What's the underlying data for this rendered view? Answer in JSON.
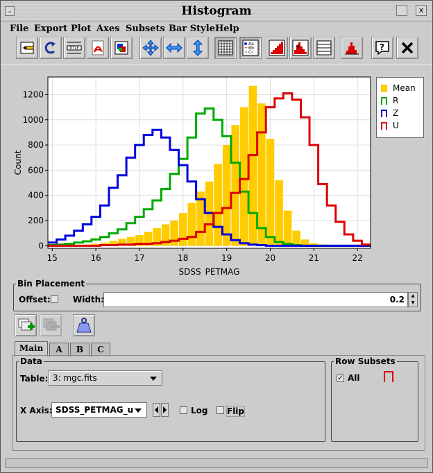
{
  "window": {
    "title": "Histogram",
    "close_icon": "x",
    "menu_icon": "-"
  },
  "menu": {
    "items": [
      "File",
      "Export",
      "Plot",
      "Axes",
      "Subsets",
      "Bar Style",
      "Help"
    ]
  },
  "toolbar": {
    "icons": [
      "import-icon",
      "replot-icon",
      "axis-labels-icon",
      "pdf-export-icon",
      "gif-export-icon",
      "move-zoom-icon",
      "x-resize-icon",
      "y-resize-icon",
      "grid-icon",
      "legend-icon",
      "cumulative-icon",
      "weighted-icon",
      "stats-icon",
      "normalise-icon",
      "help-icon",
      "close-icon"
    ]
  },
  "colors": {
    "mean": "#ffcc00",
    "r": "#00aa00",
    "z": "#0000dd",
    "u": "#dd0000",
    "grid": "#dddddd"
  },
  "chart_data": {
    "type": "bar",
    "xlabel": "SDSS_PETMAG",
    "ylabel": "Count",
    "xlim": [
      14.9,
      22.3
    ],
    "ylim": [
      -20,
      1340
    ],
    "xticks": [
      "15",
      "16",
      "17",
      "18",
      "19",
      "20",
      "21",
      "22"
    ],
    "yticks": [
      "0",
      "200",
      "400",
      "600",
      "800",
      "1000",
      "1200"
    ],
    "grid": true,
    "legend_position": "right",
    "bin_start": 14.9,
    "bin_width": 0.2,
    "series": [
      {
        "name": "Mean",
        "style": "filled",
        "values": [
          0,
          0,
          5,
          5,
          10,
          15,
          25,
          40,
          55,
          70,
          85,
          110,
          140,
          170,
          200,
          260,
          340,
          430,
          510,
          650,
          800,
          960,
          1100,
          1270,
          1130,
          850,
          520,
          280,
          120,
          50,
          20,
          10,
          5,
          2,
          0,
          0,
          0
        ]
      },
      {
        "name": "R",
        "style": "step",
        "values": [
          5,
          10,
          15,
          25,
          35,
          50,
          70,
          100,
          130,
          180,
          230,
          290,
          360,
          450,
          570,
          690,
          860,
          1050,
          1090,
          1000,
          870,
          660,
          430,
          260,
          140,
          70,
          30,
          15,
          5,
          0,
          0,
          0,
          0,
          0,
          0,
          0,
          0
        ]
      },
      {
        "name": "Z",
        "style": "step",
        "values": [
          25,
          50,
          80,
          120,
          170,
          230,
          320,
          460,
          560,
          700,
          800,
          880,
          920,
          860,
          760,
          640,
          510,
          370,
          260,
          150,
          90,
          45,
          20,
          10,
          5,
          0,
          0,
          0,
          0,
          0,
          0,
          0,
          0,
          0,
          0,
          0,
          0
        ]
      },
      {
        "name": "U",
        "style": "step",
        "values": [
          0,
          0,
          0,
          0,
          0,
          0,
          5,
          5,
          10,
          10,
          15,
          15,
          20,
          30,
          40,
          55,
          70,
          110,
          170,
          260,
          300,
          420,
          530,
          720,
          900,
          1100,
          1170,
          1210,
          1160,
          1020,
          800,
          490,
          320,
          190,
          90,
          40,
          10
        ]
      }
    ]
  },
  "legend": {
    "items": [
      "Mean",
      "R",
      "Z",
      "U"
    ]
  },
  "bin_placement": {
    "title": "Bin Placement",
    "offset_label": "Offset:",
    "offset_checked": false,
    "width_label": "Width:",
    "width_value": "0.2"
  },
  "tabs": [
    "Main",
    "A",
    "B",
    "C"
  ],
  "data_panel": {
    "title": "Data",
    "table_label": "Table:",
    "table_value": "3: mgc.fits",
    "xaxis_label": "X Axis:",
    "xaxis_value": "SDSS_PETMAG_u",
    "log_label": "Log",
    "flip_label": "Flip"
  },
  "row_subsets": {
    "title": "Row Subsets",
    "all_label": "All",
    "all_checked": true
  }
}
